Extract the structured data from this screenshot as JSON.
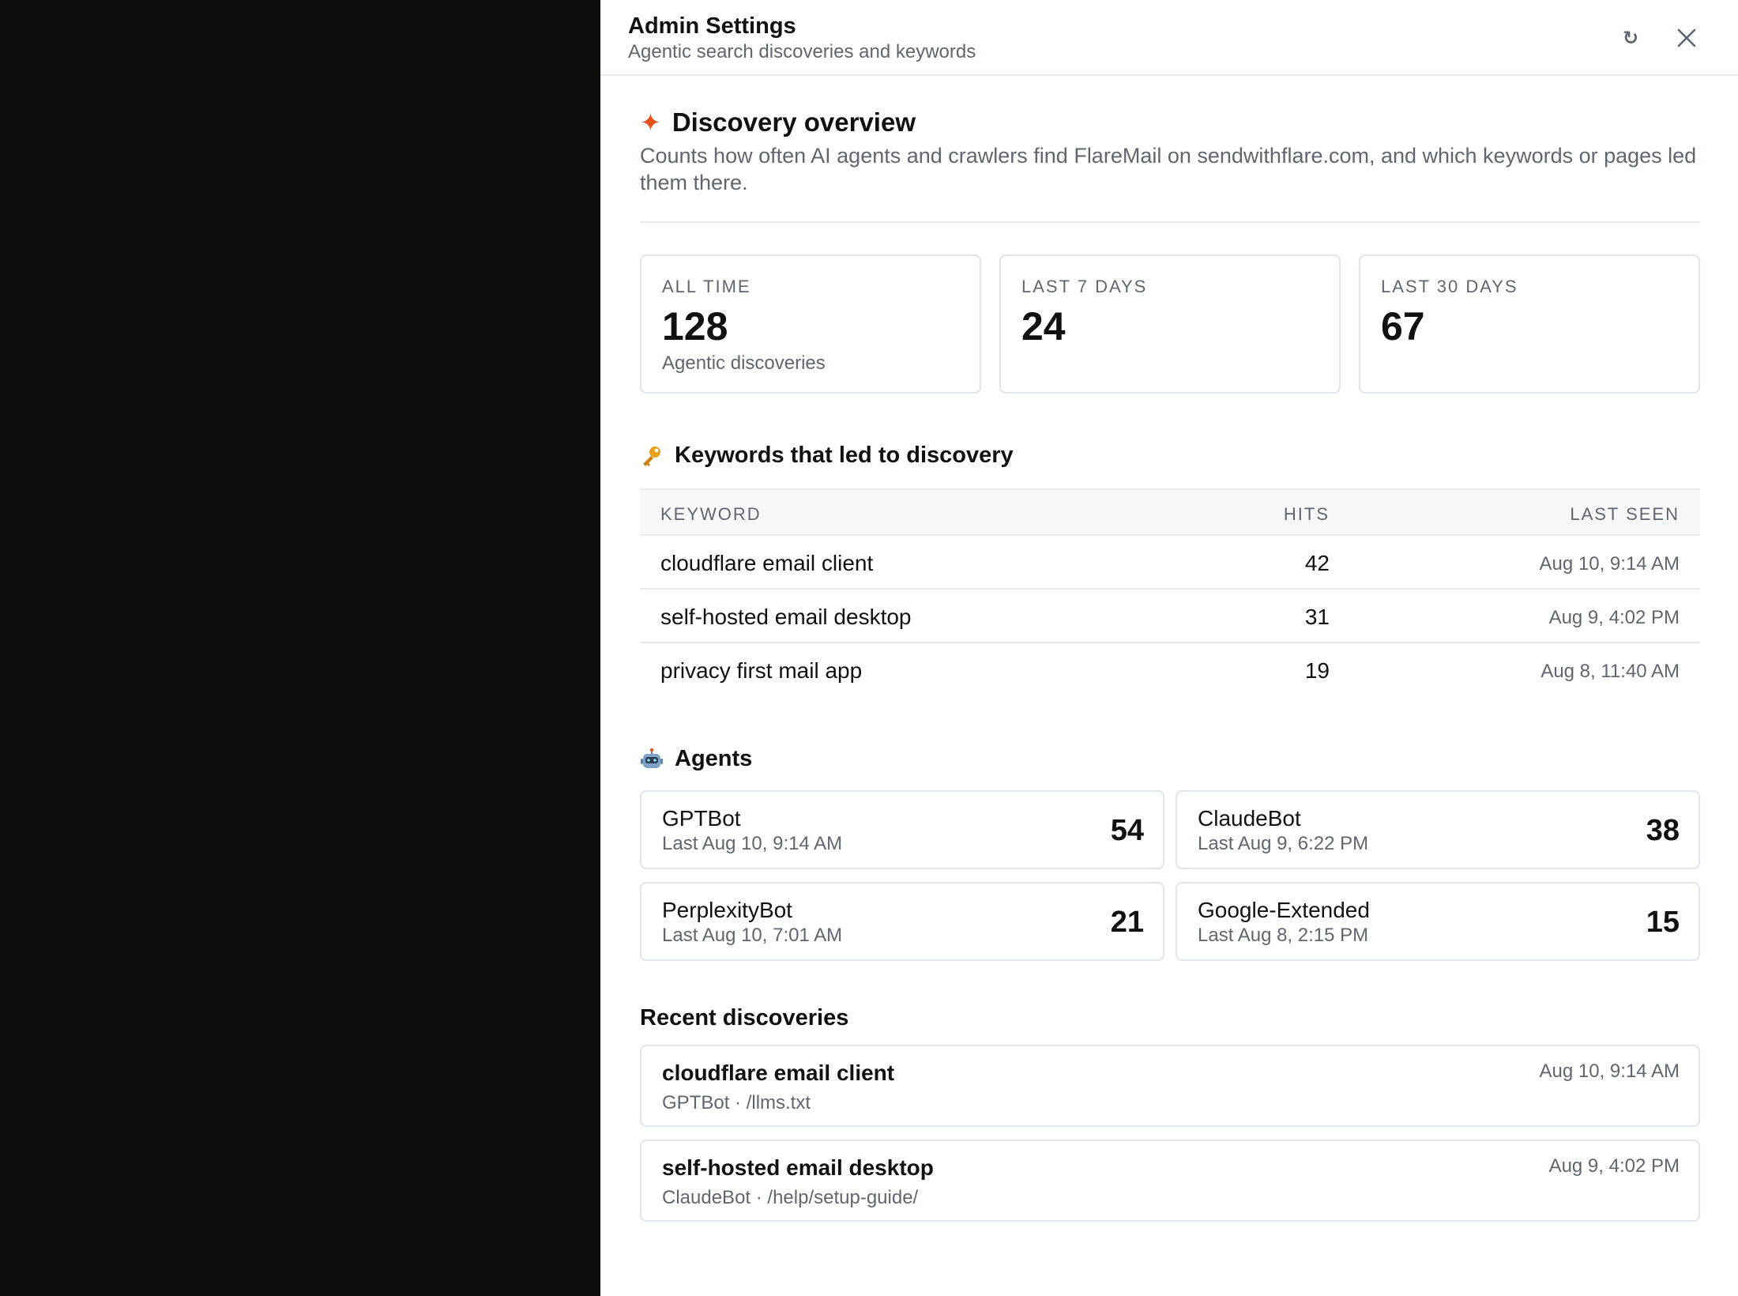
{
  "header": {
    "title": "Admin Settings",
    "subtitle": "Agentic search discoveries and keywords",
    "refresh_icon": "refresh-icon",
    "close_icon": "close-icon"
  },
  "overview": {
    "icon": "sparkle-icon",
    "title": "Discovery overview",
    "description": "Counts how often AI agents and crawlers find FlareMail on sendwithflare.com, and which keywords or pages led them there."
  },
  "stats": [
    {
      "label": "ALL TIME",
      "value": "128",
      "caption": "Agentic discoveries"
    },
    {
      "label": "LAST 7 DAYS",
      "value": "24",
      "caption": ""
    },
    {
      "label": "LAST 30 DAYS",
      "value": "67",
      "caption": ""
    }
  ],
  "keywords": {
    "icon": "key-icon",
    "title": "Keywords that led to discovery",
    "columns": {
      "keyword": "KEYWORD",
      "hits": "HITS",
      "last_seen": "LAST SEEN"
    },
    "rows": [
      {
        "keyword": "cloudflare email client",
        "hits": "42",
        "last_seen": "Aug 10, 9:14 AM"
      },
      {
        "keyword": "self-hosted email desktop",
        "hits": "31",
        "last_seen": "Aug 9, 4:02 PM"
      },
      {
        "keyword": "privacy first mail app",
        "hits": "19",
        "last_seen": "Aug 8, 11:40 AM"
      }
    ]
  },
  "agents": {
    "icon": "robot-icon",
    "title": "Agents",
    "items": [
      {
        "name": "GPTBot",
        "last": "Last Aug 10, 9:14 AM",
        "count": "54"
      },
      {
        "name": "ClaudeBot",
        "last": "Last Aug 9, 6:22 PM",
        "count": "38"
      },
      {
        "name": "PerplexityBot",
        "last": "Last Aug 10, 7:01 AM",
        "count": "21"
      },
      {
        "name": "Google-Extended",
        "last": "Last Aug 8, 2:15 PM",
        "count": "15"
      }
    ]
  },
  "recent": {
    "title": "Recent discoveries",
    "items": [
      {
        "keyword": "cloudflare email client",
        "meta": "GPTBot · /llms.txt",
        "time": "Aug 10, 9:14 AM"
      },
      {
        "keyword": "self-hosted email desktop",
        "meta": "ClaudeBot · /help/setup-guide/",
        "time": "Aug 9, 4:02 PM"
      }
    ]
  },
  "colors": {
    "accent": "#e8531c",
    "backdrop": "#110d0a",
    "muted_text": "#5f6670",
    "border": "#e1e4e8"
  }
}
